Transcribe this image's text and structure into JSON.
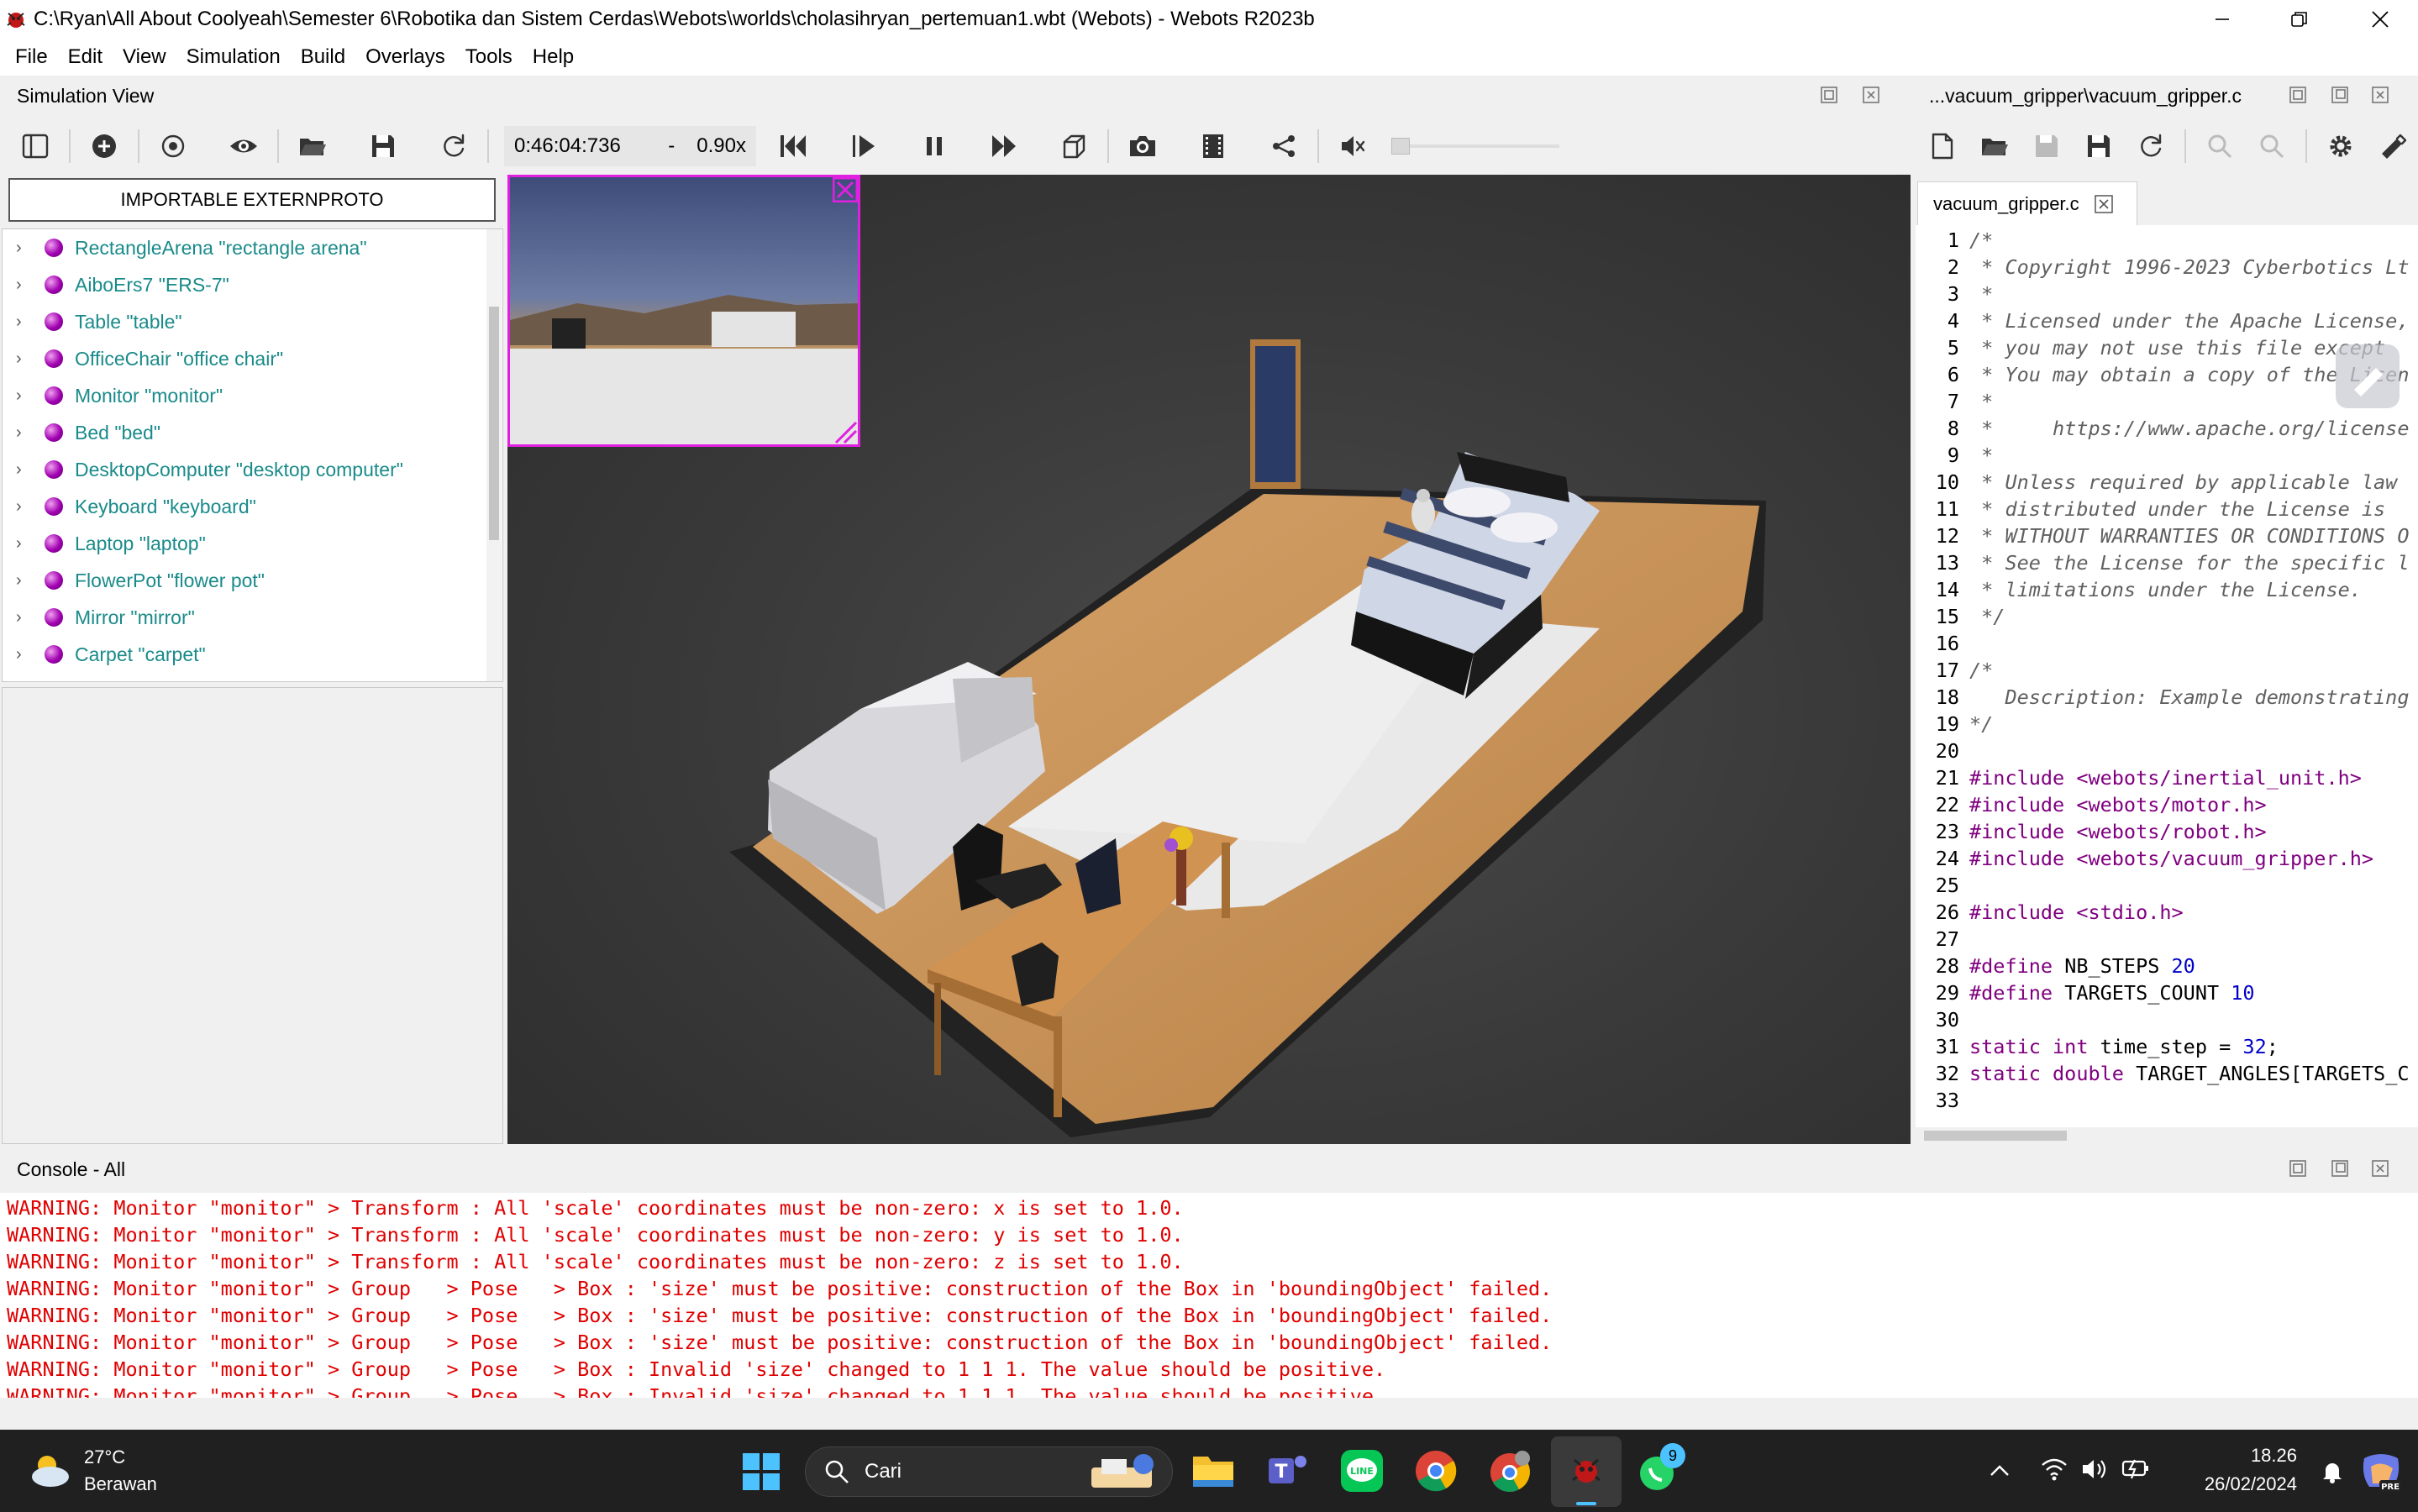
{
  "window": {
    "title": "C:\\Ryan\\All About Coolyeah\\Semester 6\\Robotika dan Sistem Cerdas\\Webots\\worlds\\cholasihryan_pertemuan1.wbt (Webots) - Webots R2023b"
  },
  "menu": [
    "File",
    "Edit",
    "View",
    "Simulation",
    "Build",
    "Overlays",
    "Tools",
    "Help"
  ],
  "simulation_view": {
    "header": "Simulation View",
    "time": "0:46:04:736",
    "speed_dash": "-",
    "speed": "0.90x"
  },
  "scene_tree": {
    "import_button": "IMPORTABLE EXTERNPROTO",
    "items": [
      {
        "label": "RectangleArena \"rectangle arena\""
      },
      {
        "label": "AiboErs7 \"ERS-7\""
      },
      {
        "label": "Table \"table\""
      },
      {
        "label": "OfficeChair \"office chair\""
      },
      {
        "label": "Monitor \"monitor\""
      },
      {
        "label": "Bed \"bed\""
      },
      {
        "label": "DesktopComputer \"desktop computer\""
      },
      {
        "label": "Keyboard \"keyboard\""
      },
      {
        "label": "Laptop \"laptop\""
      },
      {
        "label": "FlowerPot \"flower pot\""
      },
      {
        "label": "Mirror \"mirror\""
      },
      {
        "label": "Carpet \"carpet\""
      }
    ]
  },
  "editor": {
    "header": "...vacuum_gripper\\vacuum_gripper.c",
    "tab": "vacuum_gripper.c",
    "lines": [
      {
        "n": "1",
        "t": "/*",
        "k": "com"
      },
      {
        "n": "2",
        "t": " * Copyright 1996-2023 Cyberbotics Lt",
        "k": "com"
      },
      {
        "n": "3",
        "t": " *",
        "k": "com"
      },
      {
        "n": "4",
        "t": " * Licensed under the Apache License,",
        "k": "com"
      },
      {
        "n": "5",
        "t": " * you may not use this file except",
        "k": "com"
      },
      {
        "n": "6",
        "t": " * You may obtain a copy of the Licen",
        "k": "com"
      },
      {
        "n": "7",
        "t": " *",
        "k": "com"
      },
      {
        "n": "8",
        "t": " *     https://www.apache.org/license",
        "k": "com"
      },
      {
        "n": "9",
        "t": " *",
        "k": "com"
      },
      {
        "n": "10",
        "t": " * Unless required by applicable law",
        "k": "com"
      },
      {
        "n": "11",
        "t": " * distributed under the License is",
        "k": "com"
      },
      {
        "n": "12",
        "t": " * WITHOUT WARRANTIES OR CONDITIONS O",
        "k": "com"
      },
      {
        "n": "13",
        "t": " * See the License for the specific l",
        "k": "com"
      },
      {
        "n": "14",
        "t": " * limitations under the License.",
        "k": "com"
      },
      {
        "n": "15",
        "t": " */",
        "k": "com"
      },
      {
        "n": "16",
        "t": "",
        "k": "plain"
      },
      {
        "n": "17",
        "t": "/*",
        "k": "com"
      },
      {
        "n": "18",
        "t": "   Description: Example demonstrating",
        "k": "com"
      },
      {
        "n": "19",
        "t": "*/",
        "k": "com"
      },
      {
        "n": "20",
        "t": "",
        "k": "plain"
      },
      {
        "n": "21",
        "t": "#include <webots/inertial_unit.h>",
        "k": "pre"
      },
      {
        "n": "22",
        "t": "#include <webots/motor.h>",
        "k": "pre"
      },
      {
        "n": "23",
        "t": "#include <webots/robot.h>",
        "k": "pre"
      },
      {
        "n": "24",
        "t": "#include <webots/vacuum_gripper.h>",
        "k": "pre"
      },
      {
        "n": "25",
        "t": "",
        "k": "plain"
      },
      {
        "n": "26",
        "t": "#include <stdio.h>",
        "k": "pre"
      },
      {
        "n": "27",
        "t": "",
        "k": "plain"
      },
      {
        "n": "28",
        "t": "#define NB_STEPS 20",
        "k": "def"
      },
      {
        "n": "29",
        "t": "#define TARGETS_COUNT 10",
        "k": "def"
      },
      {
        "n": "30",
        "t": "",
        "k": "plain"
      },
      {
        "n": "31",
        "t": "static int time_step = 32;",
        "k": "code1"
      },
      {
        "n": "32",
        "t": "static double TARGET_ANGLES[TARGETS_C",
        "k": "code2"
      },
      {
        "n": "33",
        "t": "",
        "k": "plain"
      }
    ]
  },
  "console": {
    "header": "Console - All",
    "lines": [
      "WARNING: Monitor \"monitor\" > Transform : All 'scale' coordinates must be non-zero: x is set to 1.0.",
      "WARNING: Monitor \"monitor\" > Transform : All 'scale' coordinates must be non-zero: y is set to 1.0.",
      "WARNING: Monitor \"monitor\" > Transform : All 'scale' coordinates must be non-zero: z is set to 1.0.",
      "WARNING: Monitor \"monitor\" > Group   > Pose   > Box : 'size' must be positive: construction of the Box in 'boundingObject' failed.",
      "WARNING: Monitor \"monitor\" > Group   > Pose   > Box : 'size' must be positive: construction of the Box in 'boundingObject' failed.",
      "WARNING: Monitor \"monitor\" > Group   > Pose   > Box : 'size' must be positive: construction of the Box in 'boundingObject' failed.",
      "WARNING: Monitor \"monitor\" > Group   > Pose   > Box : Invalid 'size' changed to 1 1 1. The value should be positive.",
      "WARNING: Monitor \"monitor\" > Group   > Pose   > Box : Invalid 'size' changed to 1 1 1. The value should be positive."
    ]
  },
  "taskbar": {
    "temperature": "27°C",
    "weather": "Berawan",
    "search_placeholder": "Cari",
    "whatsapp_badge": "9",
    "time": "18.26",
    "date": "26/02/2024"
  },
  "colors": {
    "accent_console": "#e00000",
    "tree_name": "#1a8a8a",
    "overlay_border": "#e020e0",
    "floor": "#c9935a"
  }
}
